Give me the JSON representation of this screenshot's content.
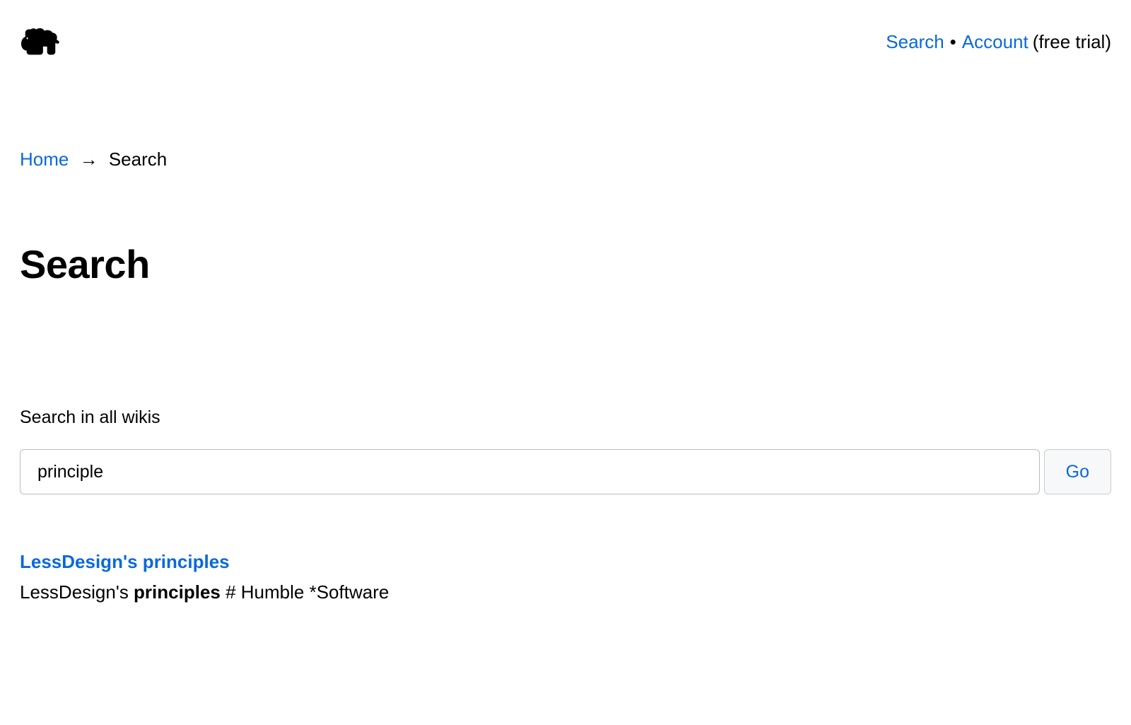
{
  "nav": {
    "search": "Search",
    "account": "Account",
    "separator": "•",
    "suffix_open": "(",
    "suffix_text": "free trial",
    "suffix_close": ")"
  },
  "breadcrumb": {
    "home": "Home",
    "arrow": "→",
    "current": "Search"
  },
  "page": {
    "title": "Search"
  },
  "search": {
    "label": "Search in all wikis",
    "value": "principle",
    "button": "Go"
  },
  "result": {
    "title": "LessDesign's principles",
    "snippet_before": "LessDesign's ",
    "snippet_highlight": "principles",
    "snippet_after": " # Humble *Software"
  }
}
